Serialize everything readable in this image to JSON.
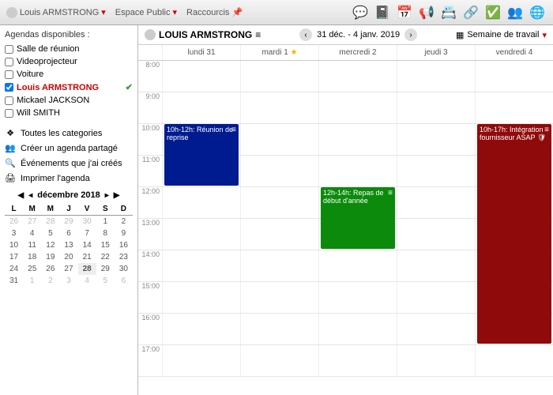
{
  "topbar": {
    "user": "Louis ARMSTRONG",
    "space": "Espace Public",
    "shortcuts": "Raccourcis"
  },
  "sidebar": {
    "available_label": "Agendas disponibles :",
    "calendars": [
      {
        "label": "Salle de réunion",
        "checked": false
      },
      {
        "label": "Videoprojecteur",
        "checked": false
      },
      {
        "label": "Voiture",
        "checked": false
      },
      {
        "label": "Louis ARMSTRONG",
        "checked": true,
        "red": true,
        "mark": true
      },
      {
        "label": "Mickael JACKSON",
        "checked": false
      },
      {
        "label": "Will SMITH",
        "checked": false
      }
    ],
    "actions": {
      "all_cat": "Toutes les categories",
      "shared": "Créer un agenda partagé",
      "mine": "Événements que j'ai créés",
      "print": "Imprimer l'agenda"
    },
    "minical": {
      "title": "décembre 2018",
      "dow": [
        "L",
        "M",
        "M",
        "J",
        "V",
        "S",
        "D"
      ],
      "rows": [
        [
          "26",
          "27",
          "28",
          "29",
          "30",
          "1",
          "2"
        ],
        [
          "3",
          "4",
          "5",
          "6",
          "7",
          "8",
          "9"
        ],
        [
          "10",
          "11",
          "12",
          "13",
          "14",
          "15",
          "16"
        ],
        [
          "17",
          "18",
          "19",
          "20",
          "21",
          "22",
          "23"
        ],
        [
          "24",
          "25",
          "26",
          "27",
          "28",
          "29",
          "30"
        ],
        [
          "31",
          "1",
          "2",
          "3",
          "4",
          "5",
          "6"
        ]
      ],
      "today": "28"
    }
  },
  "calendar": {
    "owner": "LOUIS ARMSTRONG",
    "range": "31 déc. - 4 janv. 2019",
    "view_label": "Semaine de travail",
    "days": [
      "lundi 31",
      "mardi 1",
      "mercredi 2",
      "jeudi 3",
      "vendredi 4"
    ],
    "star_day": 1,
    "hours": [
      "8:00",
      "9:00",
      "10:00",
      "11:00",
      "12:00",
      "13:00",
      "14:00",
      "15:00",
      "16:00",
      "17:00"
    ],
    "events": {
      "mon": "10h-12h: Réunion de reprise",
      "wed": "12h-14h: Repas de début d'année",
      "fri": "10h-17h: Intégration fournisseur ASAP"
    }
  }
}
